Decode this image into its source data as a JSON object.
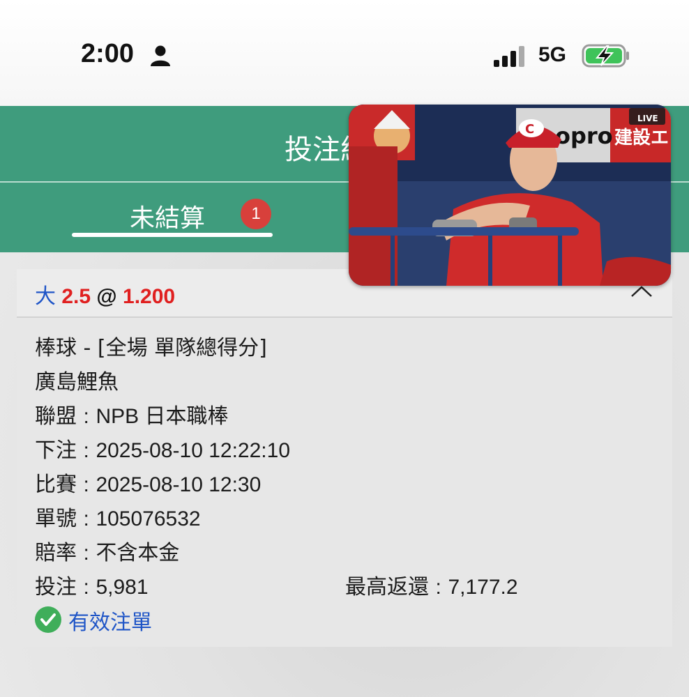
{
  "status_bar": {
    "time": "2:00",
    "network": "5G",
    "icons": [
      "person-icon",
      "signal-icon",
      "battery-charging-icon"
    ]
  },
  "header": {
    "title": "投注紀錄"
  },
  "tabs": [
    {
      "label": "未結算",
      "badge": "1",
      "active": true
    }
  ],
  "bet": {
    "side": "大",
    "handicap": "2.5",
    "at": "@",
    "odds": "1.200",
    "details": {
      "market": "棒球 - [全場 單隊總得分]",
      "team": "廣島鯉魚",
      "league_label": "聯盟",
      "league": "NPB 日本職棒",
      "bet_time_label": "下注",
      "bet_time": "2025-08-10 12:22:10",
      "match_time_label": "比賽",
      "match_time": "2025-08-10 12:30",
      "ticket_label": "單號",
      "ticket": "105076532",
      "odds_type_label": "賠率",
      "odds_type": "不含本金",
      "stake_label": "投注",
      "stake": "5,981",
      "max_return_label": "最高返還",
      "max_return": "7,177.2"
    },
    "status": "有效注單",
    "separator": ":"
  },
  "video": {
    "overlay_text": [
      "opro",
      "建設エン",
      "LIVE"
    ],
    "cap_logo": "C"
  },
  "colors": {
    "header_green": "#3f9c7d",
    "badge_red": "#d8403b",
    "accent_blue": "#1f55c7",
    "odds_red": "#e02020",
    "check_green": "#3fae5a"
  }
}
